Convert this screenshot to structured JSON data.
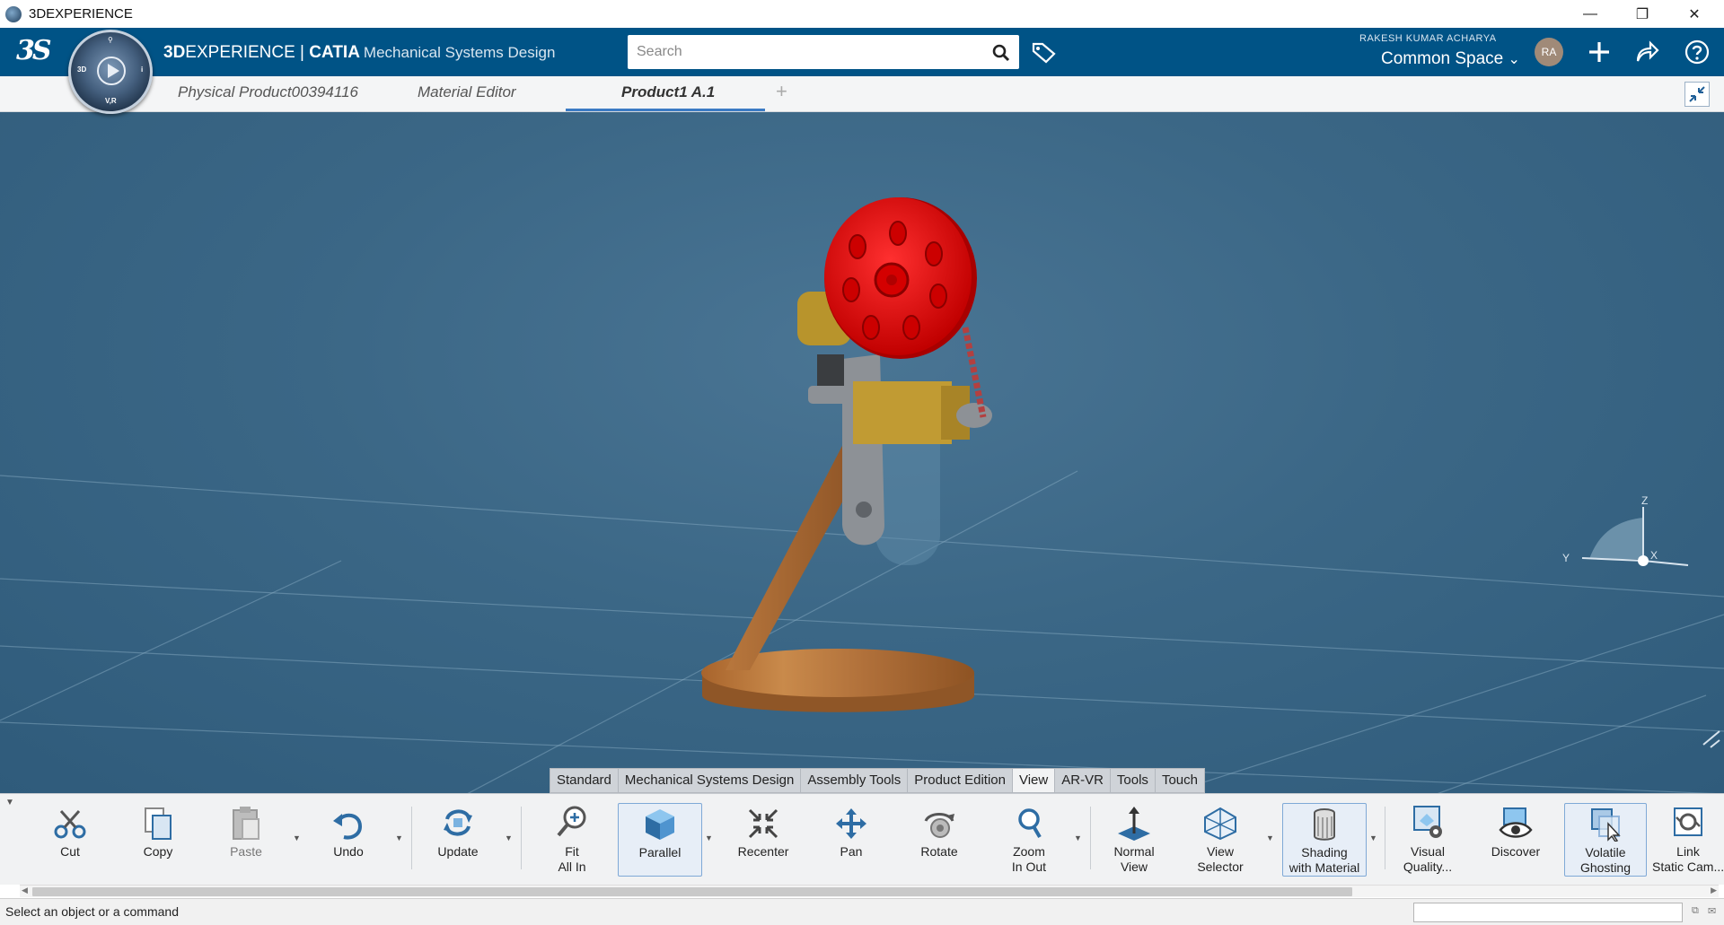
{
  "window": {
    "title": "3DEXPERIENCE",
    "minimize_glyph": "—",
    "restore_glyph": "❐",
    "close_glyph": "✕"
  },
  "topbar": {
    "logo_text": "3S",
    "compass": {
      "top": "⚲",
      "left": "3D",
      "right": "i",
      "bottom": "V,R"
    },
    "brand_prefix": "3D",
    "brand_main": "EXPERIENCE | ",
    "brand_app": "CATIA",
    "brand_sub": "Mechanical Systems Design",
    "search_placeholder": "Search",
    "user_name": "RAKESH KUMAR ACHARYA",
    "space": "Common Space",
    "space_chevron": "⌄",
    "avatar_initials": "RA",
    "icons": [
      "search-icon",
      "tag-icon",
      "add-icon",
      "share-icon",
      "help-icon"
    ],
    "accent": "#005386"
  },
  "tabs": {
    "items": [
      {
        "label": "Physical Product00394116"
      },
      {
        "label": "Material Editor"
      },
      {
        "label": "Product1 A.1"
      }
    ],
    "active_index": 2,
    "add_label": "+"
  },
  "viewport": {
    "background": "#3b6786",
    "compass_labels": {
      "z": "Z",
      "y": "Y",
      "x": "X"
    }
  },
  "workbench_tabs": [
    "Standard",
    "Mechanical Systems Design",
    "Assembly Tools",
    "Product Edition",
    "View",
    "AR-VR",
    "Tools",
    "Touch"
  ],
  "actions": {
    "cut": {
      "l1": "Cut",
      "l2": ""
    },
    "copy": {
      "l1": "Copy",
      "l2": ""
    },
    "paste": {
      "l1": "Paste",
      "l2": ""
    },
    "undo": {
      "l1": "Undo",
      "l2": ""
    },
    "update": {
      "l1": "Update",
      "l2": ""
    },
    "fit_all_in": {
      "l1": "Fit",
      "l2": "All In"
    },
    "parallel": {
      "l1": "Parallel",
      "l2": ""
    },
    "recenter": {
      "l1": "Recenter",
      "l2": ""
    },
    "pan": {
      "l1": "Pan",
      "l2": ""
    },
    "rotate": {
      "l1": "Rotate",
      "l2": ""
    },
    "zoom": {
      "l1": "Zoom",
      "l2": "In Out"
    },
    "normal_view": {
      "l1": "Normal",
      "l2": "View"
    },
    "view_selector": {
      "l1": "View",
      "l2": "Selector"
    },
    "shading": {
      "l1": "Shading",
      "l2": "with Material"
    },
    "visual_quality": {
      "l1": "Visual",
      "l2": "Quality..."
    },
    "discover": {
      "l1": "Discover",
      "l2": ""
    },
    "volatile_ghosting": {
      "l1": "Volatile",
      "l2": "Ghosting"
    },
    "link_static_cam": {
      "l1": "Link",
      "l2": "Static Cam..."
    },
    "dropdown_glyph": "▼"
  },
  "status": {
    "message": "Select an object or a command"
  }
}
